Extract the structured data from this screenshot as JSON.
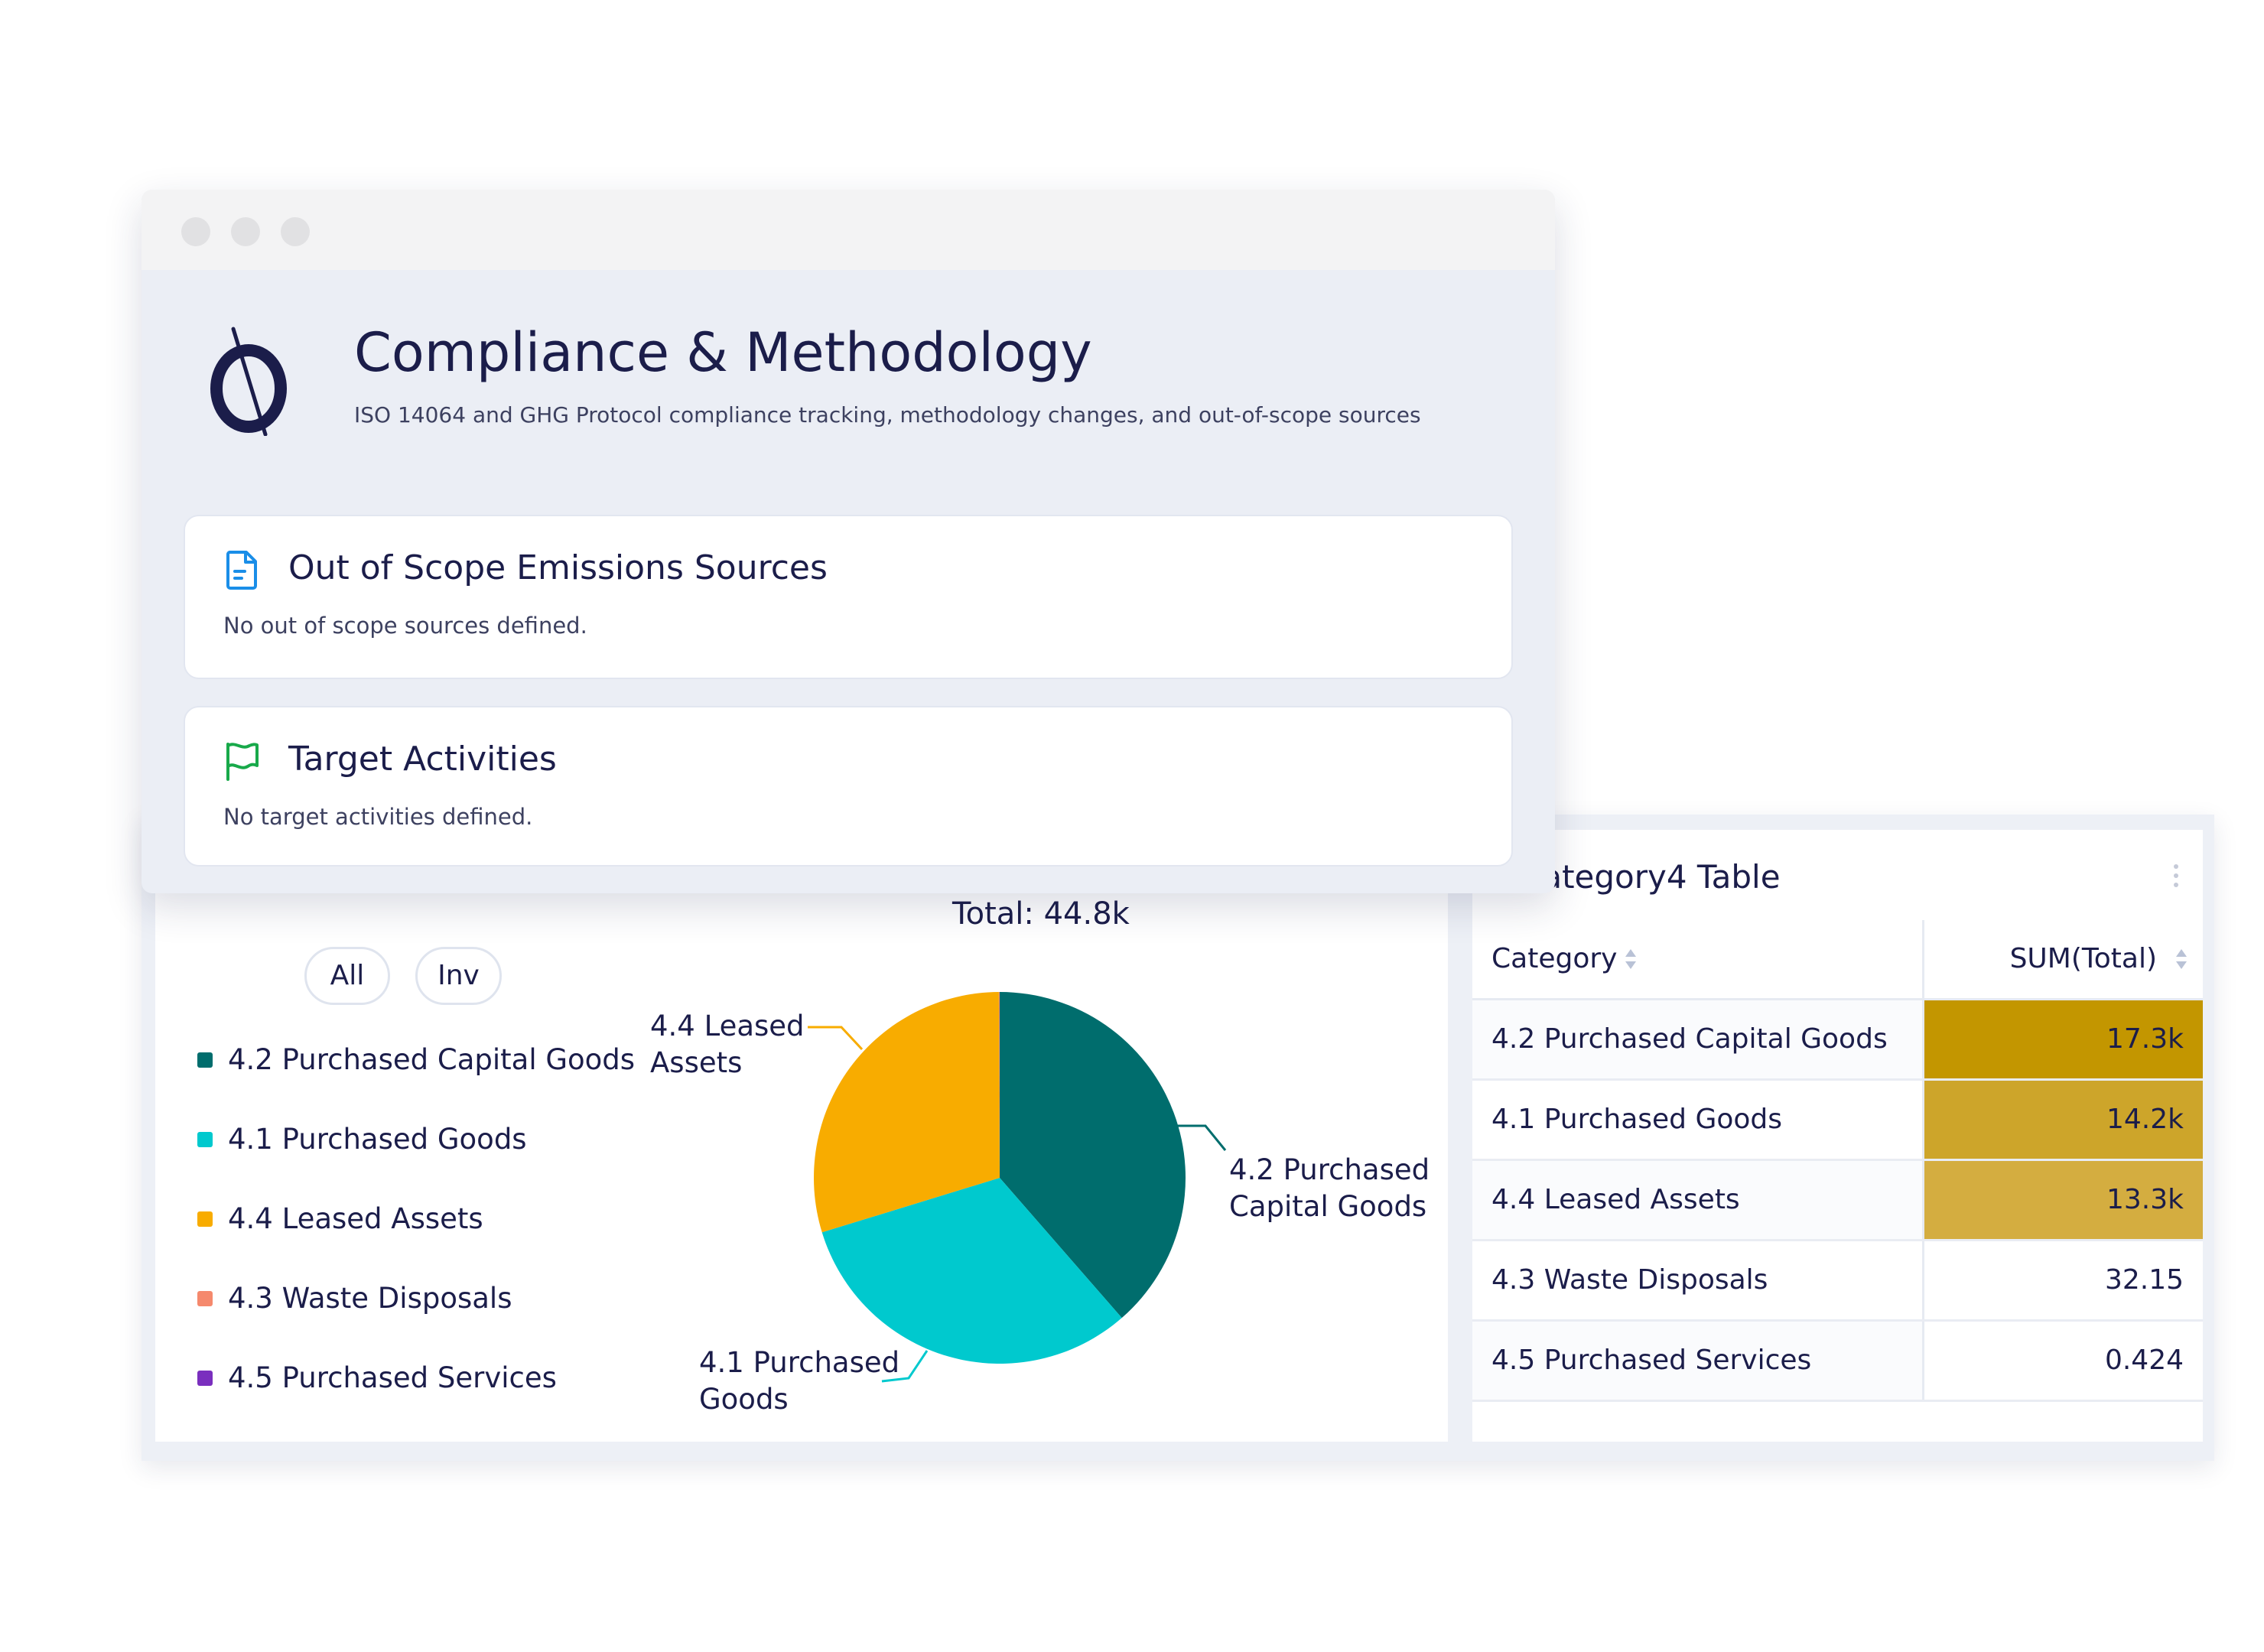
{
  "window": {
    "title": "Compliance & Methodology",
    "subtitle": "ISO 14064 and GHG Protocol compliance tracking, methodology changes, and out-of-scope sources",
    "logo_icon": "brand-logo-icon"
  },
  "cards": [
    {
      "title": "Out of Scope Emissions Sources",
      "text": "No out of scope sources defined.",
      "icon": "document-icon",
      "icon_color": "#1a8ee8"
    },
    {
      "title": "Target Activities",
      "text": "No target activities defined.",
      "icon": "flag-icon",
      "icon_color": "#18a94a"
    }
  ],
  "pie": {
    "total_label": "Total: 44.8k",
    "filters": [
      "All",
      "Inv"
    ],
    "legend": [
      {
        "label": "4.2 Purchased Capital Goods",
        "color": "#006d6d"
      },
      {
        "label": "4.1 Purchased Goods",
        "color": "#00c9ce"
      },
      {
        "label": "4.4 Leased Assets",
        "color": "#f8ac00"
      },
      {
        "label": "4.3 Waste Disposals",
        "color": "#f5896d"
      },
      {
        "label": "4.5 Purchased Services",
        "color": "#7a2fbe"
      }
    ],
    "slice_labels": {
      "capital": "4.2 Purchased\nCapital Goods",
      "goods": "4.1 Purchased\nGoods",
      "leased": "4.4 Leased\nAssets"
    }
  },
  "chart_data": {
    "type": "pie",
    "categories": [
      "4.2 Purchased Capital Goods",
      "4.1 Purchased Goods",
      "4.4 Leased Assets",
      "4.3 Waste Disposals",
      "4.5 Purchased Services"
    ],
    "values": [
      17300,
      14200,
      13300,
      32.15,
      0.424
    ],
    "colors": [
      "#006d6d",
      "#00c9ce",
      "#f8ac00",
      "#f5896d",
      "#7a2fbe"
    ],
    "title": "Total: 44.8k",
    "legend_position": "left"
  },
  "table": {
    "title": "Category4 Table",
    "columns": [
      "Category",
      "SUM(Total)"
    ],
    "rows": [
      {
        "category": "4.2 Purchased Capital Goods",
        "value": "17.3k",
        "shade": "#c39600"
      },
      {
        "category": "4.1 Purchased Goods",
        "value": "14.2k",
        "shade": "#cda52a"
      },
      {
        "category": "4.4 Leased Assets",
        "value": "13.3k",
        "shade": "#d4ad40"
      },
      {
        "category": "4.3 Waste Disposals",
        "value": "32.15",
        "shade": "#ffffff"
      },
      {
        "category": "4.5 Purchased Services",
        "value": "0.424",
        "shade": "#ffffff"
      }
    ]
  }
}
